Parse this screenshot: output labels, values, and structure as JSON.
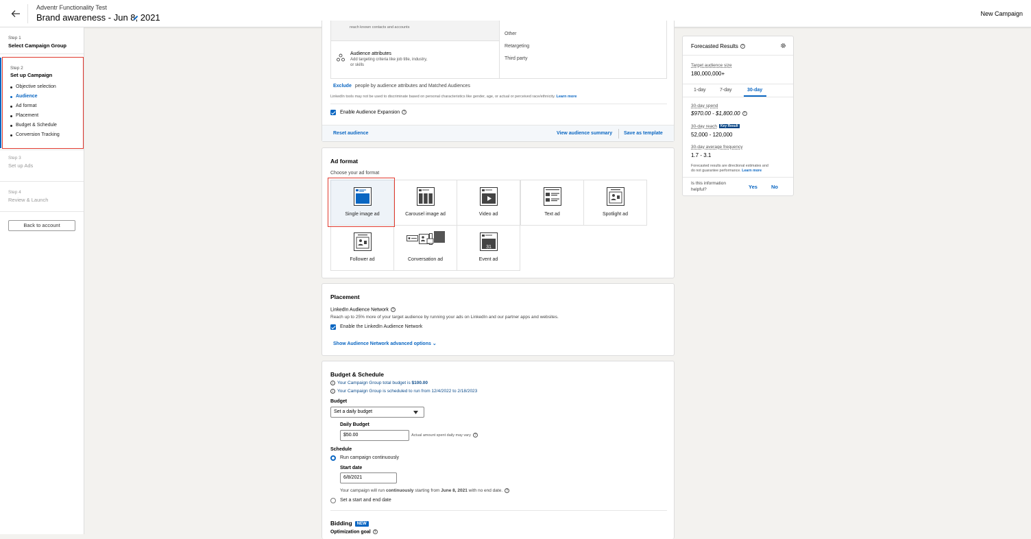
{
  "header": {
    "account_name": "Adventr Functionality Test",
    "campaign_title": "Brand awareness - Jun 8, 2021",
    "new_campaign_label": "New Campaign"
  },
  "sidebar": {
    "steps": [
      {
        "num": "Step 1",
        "name": "Select Campaign Group"
      },
      {
        "num": "Step 2",
        "name": "Set up Campaign"
      },
      {
        "num": "Step 3",
        "name": "Set up Ads"
      },
      {
        "num": "Step 4",
        "name": "Review & Launch"
      }
    ],
    "substeps": [
      "Objective selection",
      "Audience",
      "Ad format",
      "Placement",
      "Budget & Schedule",
      "Conversion Tracking"
    ],
    "back_label": "Back to account"
  },
  "audience": {
    "reach_text": "reach known contacts and accounts",
    "attr_title": "Audience attributes",
    "attr_desc_1": "Add targeting criteria like job title, industry,",
    "attr_desc_2": "or skills",
    "options": [
      "Other",
      "Retargeting",
      "Third party"
    ],
    "exclude_label": "Exclude",
    "exclude_text": "people by audience attributes and Matched Audiences",
    "disclaimer": "LinkedIn tools may not be used to discriminate based on personal characteristics like gender, age, or actual or perceived race/ethnicity.",
    "learn_more": "Learn more",
    "expansion_label": "Enable Audience Expansion",
    "reset_label": "Reset audience",
    "view_summary_label": "View audience summary",
    "save_template_label": "Save as template"
  },
  "ad_format": {
    "title": "Ad format",
    "subtitle": "Choose your ad format",
    "tiles": [
      {
        "label": "Single image ad",
        "icon": "single-image-icon"
      },
      {
        "label": "Carousel image ad",
        "icon": "carousel-icon"
      },
      {
        "label": "Video ad",
        "icon": "video-icon"
      },
      {
        "label": "Text ad",
        "icon": "text-ad-icon"
      },
      {
        "label": "Spotlight ad",
        "icon": "spotlight-icon"
      },
      {
        "label": "Follower ad",
        "icon": "follower-icon"
      },
      {
        "label": "Conversation ad",
        "icon": "conversation-icon"
      },
      {
        "label": "Event ad",
        "icon": "event-icon"
      }
    ],
    "event_day": "31"
  },
  "placement": {
    "title": "Placement",
    "network_title": "LinkedIn Audience Network",
    "network_desc": "Reach up to 25% more of your target audience by running your ads on LinkedIn and our partner apps and websites.",
    "enable_label": "Enable the LinkedIn Audience Network",
    "advanced_label": "Show Audience Network advanced options"
  },
  "budget": {
    "title": "Budget & Schedule",
    "note_1_pre": "Your Campaign Group total budget is ",
    "note_1_val": "$100.00",
    "note_2_pre": "Your Campaign Group is scheduled to run from ",
    "note_2_val": "12/4/2022 to 2/18/2023",
    "budget_label": "Budget",
    "budget_select": "Set a daily budget",
    "daily_label": "Daily Budget",
    "daily_value": "$50.00",
    "daily_note": "Actual amount spent daily may vary",
    "schedule_label": "Schedule",
    "run_continuous": "Run campaign continuously",
    "start_label": "Start date",
    "start_value": "6/8/2021",
    "run_note_1": "Your campaign will run ",
    "run_note_bold": "continuously",
    "run_note_2": " starting from ",
    "run_note_date": "June 8, 2021",
    "run_note_3": " with no end date.",
    "set_dates": "Set a start and end date",
    "bidding_label": "Bidding",
    "new_badge": "NEW",
    "optimization_label": "Optimization goal"
  },
  "forecast": {
    "title": "Forecasted Results",
    "audience_size_label": "Target audience size",
    "audience_size_value": "180,000,000+",
    "tabs": [
      "1-day",
      "7-day",
      "30-day"
    ],
    "active_tab": "30-day",
    "spend_label": "30-day spend",
    "spend_value": "$970.00 - $1,800.00",
    "reach_label": "30-day reach",
    "key_result": "Key Result",
    "reach_value": "52,000 - 120,000",
    "freq_label": "30-day average frequency",
    "freq_value": "1.7 - 3.1",
    "disclaimer_1": "Forecasted results are directional estimates and",
    "disclaimer_2": "do not guarantee performance.",
    "learn_more": "Learn more",
    "helpful_q1": "Is this information",
    "helpful_q2": "helpful?",
    "yes": "Yes",
    "no": "No"
  },
  "colors": {
    "accent": "#0a66c2",
    "highlight": "#e0372c",
    "page_bg": "#f3f2ef"
  }
}
